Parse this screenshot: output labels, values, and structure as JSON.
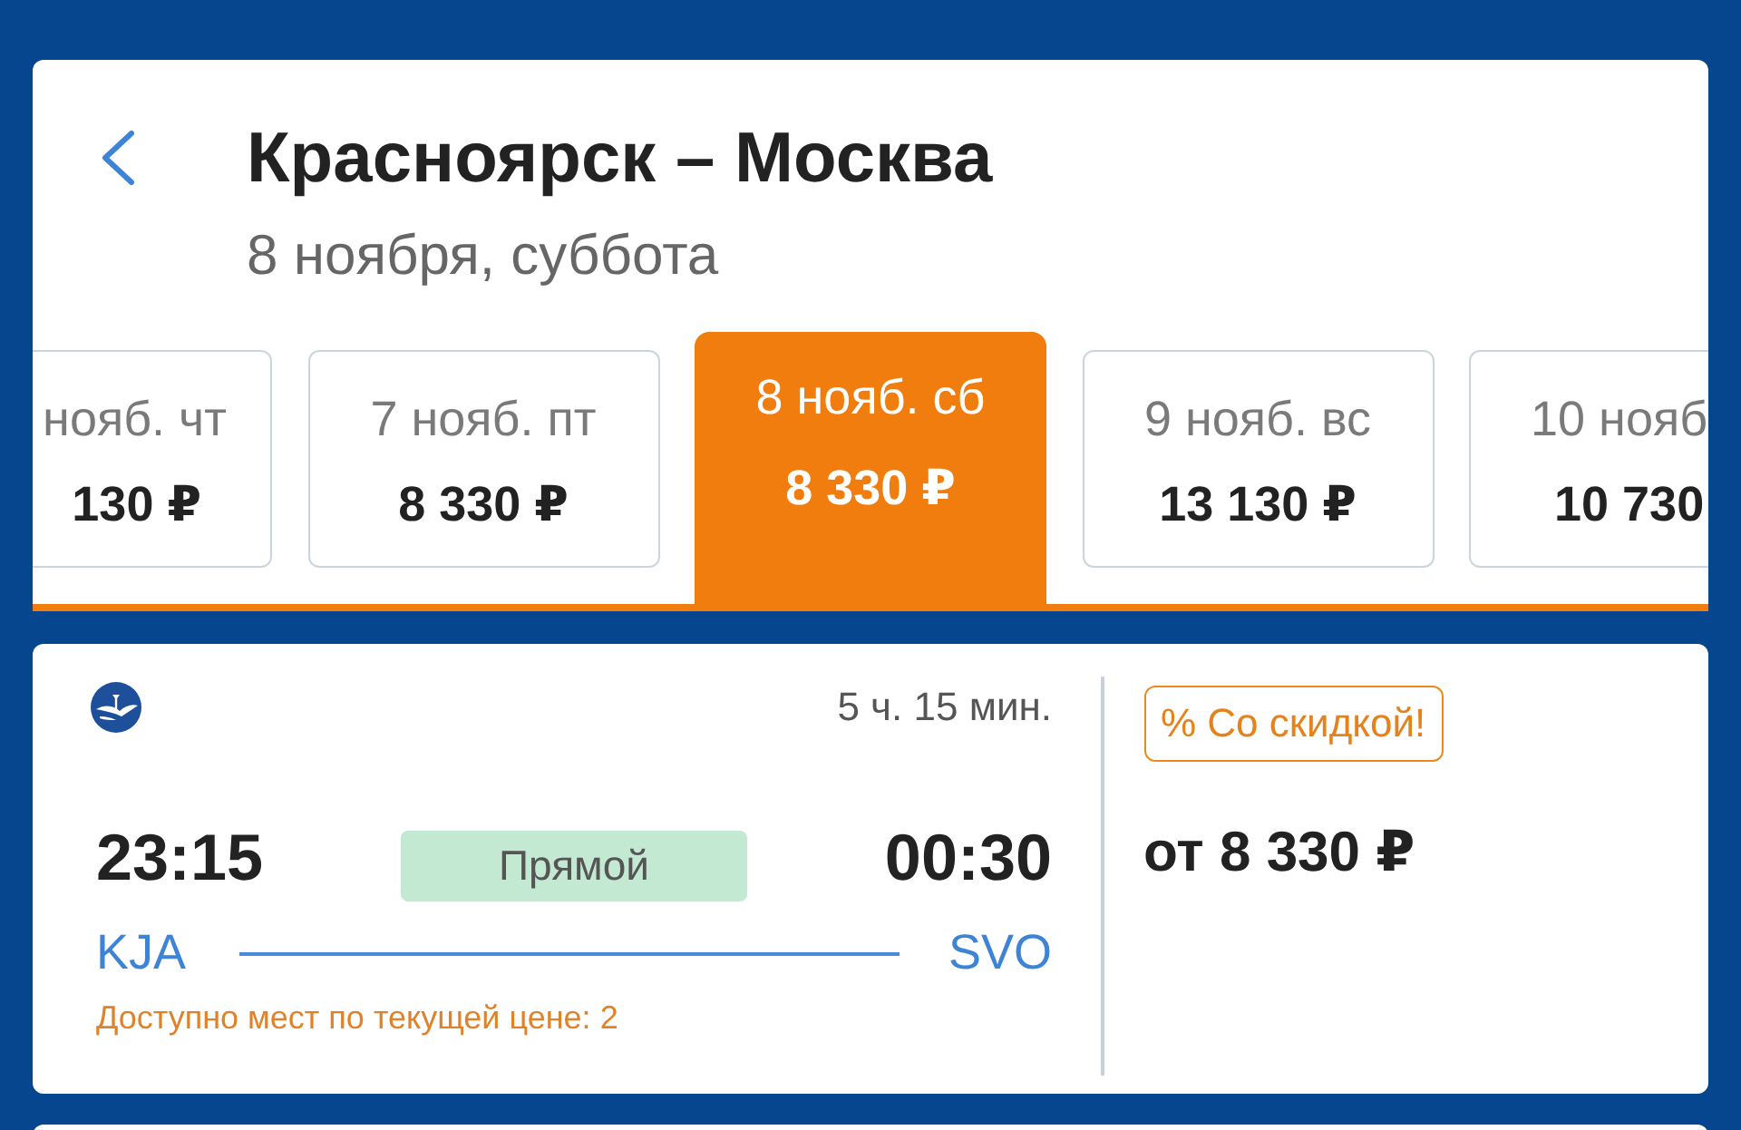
{
  "header": {
    "title": "Красноярск – Москва",
    "subtitle": "8 ноября, суббота"
  },
  "date_tabs": [
    {
      "date": "нояб. чт",
      "price": "130 ₽",
      "selected": false
    },
    {
      "date": "7 нояб. пт",
      "price": "8 330 ₽",
      "selected": false
    },
    {
      "date": "8 нояб. сб",
      "price": "8 330 ₽",
      "selected": true
    },
    {
      "date": "9 нояб. вс",
      "price": "13 130 ₽",
      "selected": false
    },
    {
      "date": "10 нояб",
      "price": "10 730",
      "selected": false
    }
  ],
  "flight": {
    "duration": "5 ч. 15 мин.",
    "departure": {
      "time": "23:15",
      "airport": "KJA"
    },
    "stops": "Прямой",
    "arrival": {
      "time": "00:30",
      "airport": "SVO"
    },
    "seats_note": "Доступно мест по текущей цене: 2",
    "badge": "% Со скидкой!",
    "price": "от 8 330 ₽"
  }
}
